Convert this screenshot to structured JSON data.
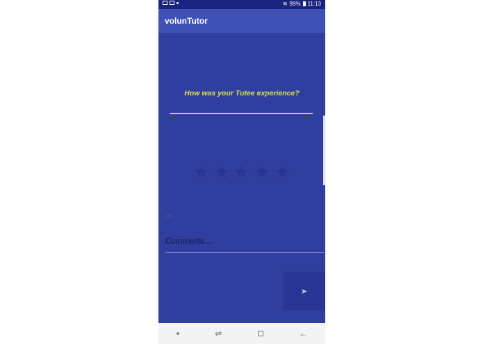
{
  "status_bar": {
    "time": "11:13",
    "battery": "99%",
    "icons": [
      "gallery-icon",
      "image-icon",
      "messenger-icon",
      "alarm-icon",
      "mute-icon",
      "nfc-icon",
      "wifi-icon",
      "signal-icon",
      "battery-icon"
    ]
  },
  "app_bar": {
    "title": "volunTutor"
  },
  "feedback": {
    "question": "How was your Tutee experience?",
    "rating": {
      "max": 5,
      "value": 0
    },
    "small_label": "text",
    "comments_placeholder": "Comments...."
  },
  "send_button": {
    "icon": "send-icon",
    "glyph": "➤"
  },
  "nav_bar": {
    "icons": [
      "nav-dot-icon",
      "recent-apps-icon",
      "home-icon",
      "back-icon"
    ]
  },
  "colors": {
    "background": "#303f9f",
    "app_bar": "#3f51b5",
    "status_bar": "#1a237e",
    "question_text": "#dce34a",
    "star": "#283593"
  }
}
